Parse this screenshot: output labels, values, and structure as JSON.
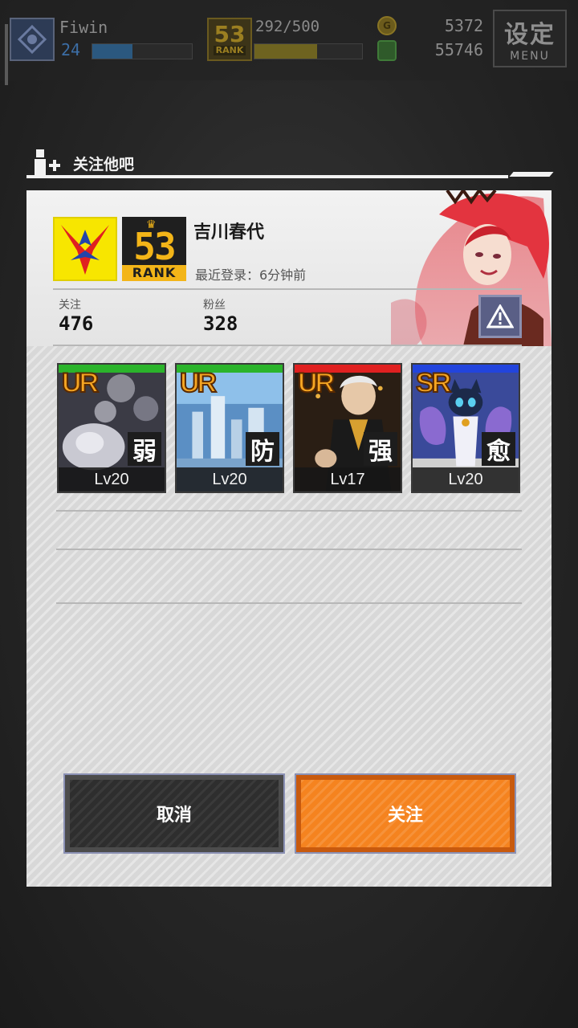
{
  "hud": {
    "player_name": "Fiwin",
    "player_level": "24",
    "xp_fraction": 0.4,
    "rank": "53",
    "rank_label": "RANK",
    "stamina": "292/500",
    "stamina_fraction": 0.58,
    "coins": "5372",
    "cash": "55746",
    "menu_label": "设定",
    "menu_sub": "MENU"
  },
  "dialog": {
    "title": "关注他吧",
    "player": {
      "name": "吉川春代",
      "rank": "53",
      "rank_label": "RANK",
      "last_login": "最近登录：6分钟前"
    },
    "stats": {
      "following_label": "关注",
      "following_value": "476",
      "followers_label": "粉丝",
      "followers_value": "328"
    },
    "cards": [
      {
        "rarity": "UR",
        "attribute": "弱",
        "level": "Lv20",
        "color": "#2bb42b"
      },
      {
        "rarity": "UR",
        "attribute": "防",
        "level": "Lv20",
        "color": "#2bb42b"
      },
      {
        "rarity": "UR",
        "attribute": "强",
        "level": "Lv17",
        "color": "#e02020"
      },
      {
        "rarity": "SR",
        "attribute": "愈",
        "level": "Lv20",
        "color": "#2244dd"
      }
    ],
    "buttons": {
      "cancel": "取消",
      "follow": "关注"
    }
  },
  "colors": {
    "accent": "#f5831f",
    "rank_gold": "#f3b518",
    "emblem_yellow": "#f7e600"
  }
}
